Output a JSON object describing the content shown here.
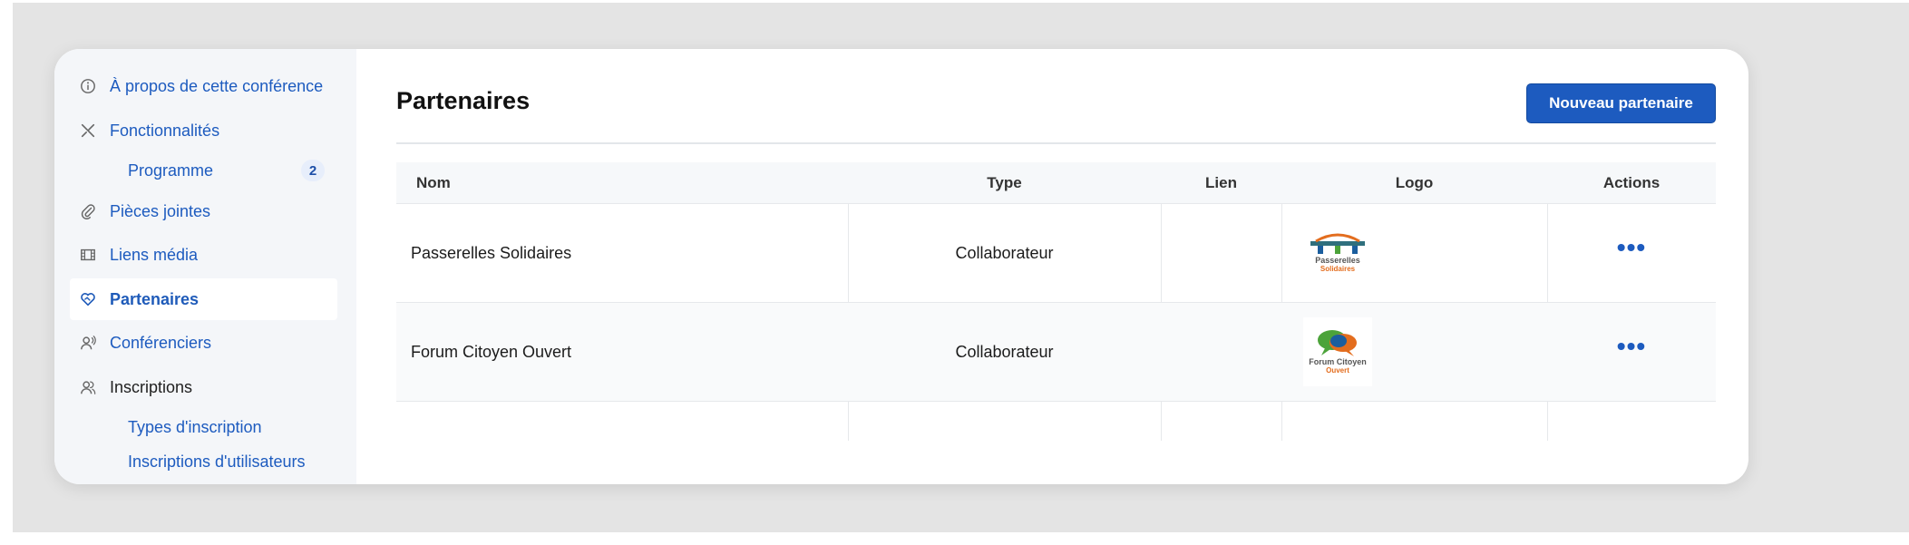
{
  "sidebar": {
    "items": [
      {
        "label": "À propos de cette conférence",
        "icon": "info-icon"
      },
      {
        "label": "Fonctionnalités",
        "icon": "tools-icon"
      },
      {
        "label": "Programme",
        "badge": "2"
      },
      {
        "label": "Pièces jointes",
        "icon": "paperclip-icon"
      },
      {
        "label": "Liens média",
        "icon": "film-icon"
      },
      {
        "label": "Partenaires",
        "icon": "heart-handshake-icon",
        "active": true
      },
      {
        "label": "Conférenciers",
        "icon": "speaker-icon"
      },
      {
        "label": "Inscriptions",
        "icon": "users-icon"
      },
      {
        "label": "Types d'inscription"
      },
      {
        "label": "Inscriptions d'utilisateurs"
      }
    ]
  },
  "main": {
    "title": "Partenaires",
    "new_button": "Nouveau partenaire",
    "table": {
      "headers": [
        "Nom",
        "Type",
        "Lien",
        "Logo",
        "Actions"
      ],
      "rows": [
        {
          "name": "Passerelles Solidaires",
          "type": "Collaborateur",
          "link": "",
          "logo_line1": "Passerelles",
          "logo_line2": "Solidaires",
          "actions": "•••"
        },
        {
          "name": "Forum Citoyen Ouvert",
          "type": "Collaborateur",
          "link": "",
          "logo_line1": "Forum Citoyen",
          "logo_line2": "Ouvert",
          "actions": "•••"
        }
      ]
    }
  },
  "colors": {
    "accent": "#1d5bbf",
    "sidebar_bg": "#f4f6f9",
    "background": "#e4e4e4"
  }
}
